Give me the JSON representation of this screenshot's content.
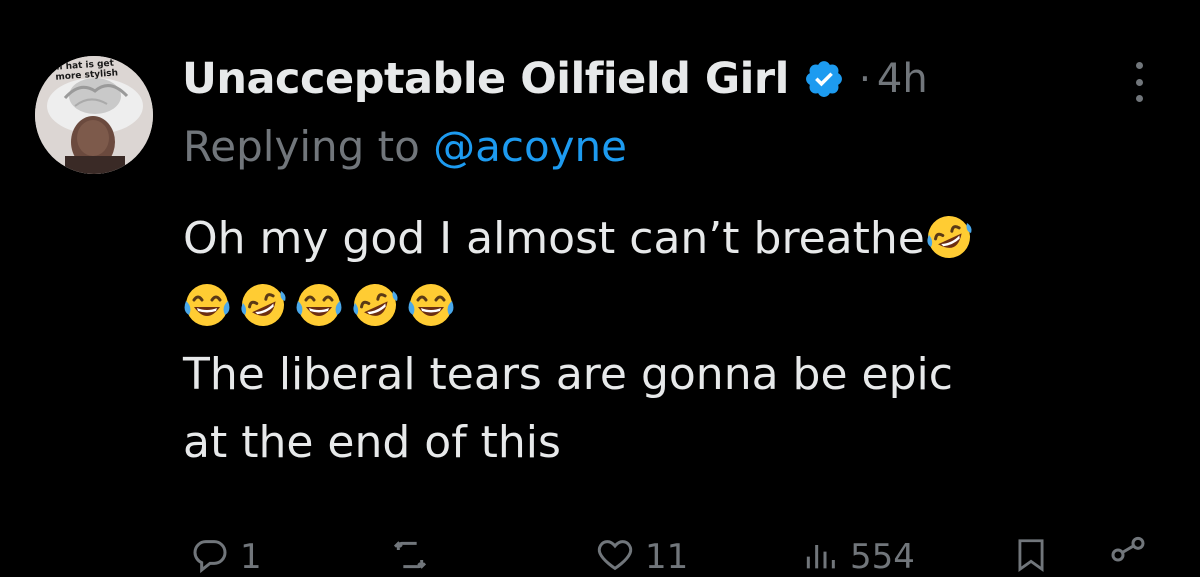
{
  "tweet": {
    "author_name": "Unacceptable Oilfield Girl",
    "verified": true,
    "separator": "·",
    "time": "4h",
    "replying_prefix": "Replying to ",
    "replying_handle": "@acoyne",
    "body_line1": "Oh my god I almost can’t breathe",
    "body_line3": "The liberal tears are gonna be epic",
    "body_line4": "at the end of this",
    "emojis_line1_end": [
      "rolling-on-floor-laughing"
    ],
    "emojis_line2": [
      "face-with-tears-of-joy",
      "rolling-on-floor-laughing",
      "face-with-tears-of-joy",
      "rolling-on-floor-laughing",
      "face-with-tears-of-joy"
    ]
  },
  "avatar": {
    "caption_line1": "Oil hat is get",
    "caption_line2": "more stylish"
  },
  "actions": {
    "reply_count": "1",
    "retweet_count": "",
    "like_count": "11",
    "views_count": "554"
  },
  "colors": {
    "background": "#000000",
    "text_primary": "#e7e9ea",
    "text_secondary": "#71767b",
    "link": "#1d9bf0",
    "verified": "#1d9bf0"
  }
}
